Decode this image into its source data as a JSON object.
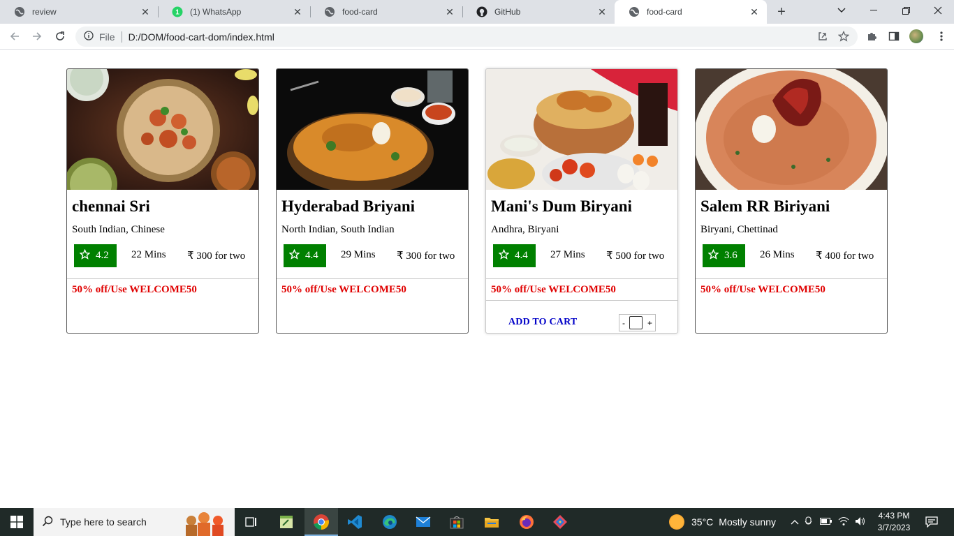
{
  "browser": {
    "tabs": [
      {
        "title": "review",
        "favicon": "globe-icon",
        "active": false
      },
      {
        "title": "(1) WhatsApp",
        "favicon": "whatsapp-icon",
        "active": false,
        "badge": "1"
      },
      {
        "title": "food-card",
        "favicon": "globe-icon",
        "active": false
      },
      {
        "title": "GitHub",
        "favicon": "github-icon",
        "active": false
      },
      {
        "title": "food-card",
        "favicon": "globe-icon",
        "active": true
      }
    ],
    "address": {
      "scheme_label": "File",
      "url": "D:/DOM/food-cart-dom/index.html"
    }
  },
  "cards": [
    {
      "name": "chennai Sri",
      "cuisine": "South Indian, Chinese",
      "rating": "4.2",
      "time": "22 Mins",
      "price": "₹ 300 for two",
      "offer": "50% off/Use WELCOME50"
    },
    {
      "name": "Hyderabad Briyani",
      "cuisine": "North Indian, South Indian",
      "rating": "4.4",
      "time": "29 Mins",
      "price": "₹ 300 for two",
      "offer": "50% off/Use WELCOME50"
    },
    {
      "name": "Mani's Dum Biryani",
      "cuisine": "Andhra, Biryani",
      "rating": "4.4",
      "time": "27 Mins",
      "price": "₹ 500 for two",
      "offer": "50% off/Use WELCOME50",
      "add_to_cart_label": "ADD TO CART",
      "qty_minus": "-",
      "qty_plus": "+"
    },
    {
      "name": "Salem RR Biriyani",
      "cuisine": "Biryani, Chettinad",
      "rating": "3.6",
      "time": "26 Mins",
      "price": "₹ 400 for two",
      "offer": "50% off/Use WELCOME50"
    }
  ],
  "taskbar": {
    "search_placeholder": "Type here to search",
    "weather": {
      "temp": "35°C",
      "condition": "Mostly sunny"
    },
    "clock": {
      "time": "4:43 PM",
      "date": "3/7/2023"
    }
  },
  "colors": {
    "rating_bg": "#008000",
    "offer_text": "#e00000",
    "cart_text": "#0000c8"
  }
}
